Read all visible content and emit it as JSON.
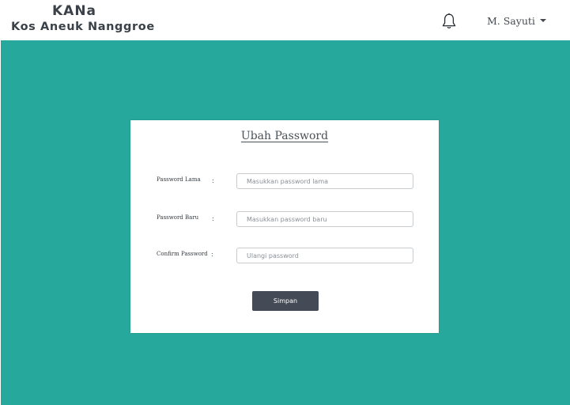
{
  "brand": {
    "short_name": "KANa",
    "full_name": "Kos Aneuk Nanggroe"
  },
  "header": {
    "notification_icon": "bell-icon",
    "user_name": "M. Sayuti"
  },
  "colors": {
    "background": "#27a89c",
    "button": "#454b56"
  },
  "form": {
    "title": "Ubah Password",
    "fields": [
      {
        "label": "Password Lama",
        "colon": ":",
        "placeholder": "Masukkan password lama",
        "value": ""
      },
      {
        "label": "Password Baru",
        "colon": ":",
        "placeholder": "Masukkan password baru",
        "value": ""
      },
      {
        "label": "Confirm Password",
        "colon": ":",
        "placeholder": "Ulangi password",
        "value": ""
      }
    ],
    "submit_label": "Simpan"
  }
}
